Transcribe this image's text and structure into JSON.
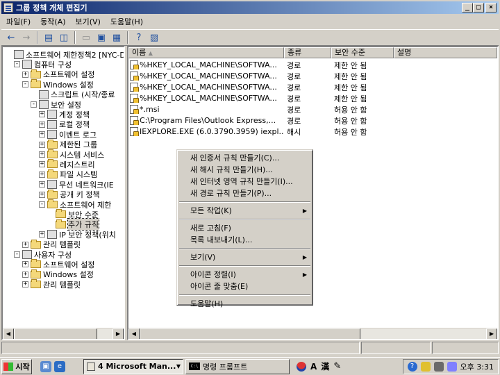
{
  "window": {
    "title": "그룹 정책 개체 편집기",
    "buttons": [
      "_",
      "□",
      "×"
    ]
  },
  "menubar": [
    "파일(F)",
    "동작(A)",
    "보기(V)",
    "도움말(H)"
  ],
  "tree": [
    {
      "label": "소프트웨어 제한정책2 [NYC-D",
      "level": 0,
      "expander": "",
      "icon": "policy-icon"
    },
    {
      "label": "컴퓨터 구성",
      "level": 1,
      "expander": "-",
      "icon": "computer-icon"
    },
    {
      "label": "소프트웨어 설정",
      "level": 2,
      "expander": "+",
      "icon": "folder-icon"
    },
    {
      "label": "Windows 설정",
      "level": 2,
      "expander": "-",
      "icon": "folder-icon"
    },
    {
      "label": "스크립트 (시작/종료",
      "level": 3,
      "expander": "",
      "icon": "script-icon"
    },
    {
      "label": "보안 설정",
      "level": 3,
      "expander": "-",
      "icon": "security-icon"
    },
    {
      "label": "계정 정책",
      "level": 4,
      "expander": "+",
      "icon": "policy-icon"
    },
    {
      "label": "로컬 정책",
      "level": 4,
      "expander": "+",
      "icon": "policy-icon"
    },
    {
      "label": "이벤트 로그",
      "level": 4,
      "expander": "+",
      "icon": "log-icon"
    },
    {
      "label": "제한된 그룹",
      "level": 4,
      "expander": "+",
      "icon": "folder-icon"
    },
    {
      "label": "시스템 서비스",
      "level": 4,
      "expander": "+",
      "icon": "folder-icon"
    },
    {
      "label": "레지스트리",
      "level": 4,
      "expander": "+",
      "icon": "folder-icon"
    },
    {
      "label": "파일 시스템",
      "level": 4,
      "expander": "+",
      "icon": "folder-icon"
    },
    {
      "label": "무선 네트워크(IE",
      "level": 4,
      "expander": "+",
      "icon": "antenna-icon"
    },
    {
      "label": "공개 키 정책",
      "level": 4,
      "expander": "+",
      "icon": "folder-icon"
    },
    {
      "label": "소프트웨어 제한",
      "level": 4,
      "expander": "-",
      "icon": "folder-icon"
    },
    {
      "label": "보안 수준",
      "level": 5,
      "expander": "",
      "icon": "folder-icon"
    },
    {
      "label": "추가 규칙",
      "level": 5,
      "expander": "",
      "icon": "folder-icon",
      "selected": true
    },
    {
      "label": "IP 보안 정책(위치",
      "level": 4,
      "expander": "+",
      "icon": "ip-security-icon"
    },
    {
      "label": "관리 템플릿",
      "level": 2,
      "expander": "+",
      "icon": "folder-icon"
    },
    {
      "label": "사용자 구성",
      "level": 1,
      "expander": "-",
      "icon": "user-icon"
    },
    {
      "label": "소프트웨어 설정",
      "level": 2,
      "expander": "+",
      "icon": "folder-icon"
    },
    {
      "label": "Windows 설정",
      "level": 2,
      "expander": "+",
      "icon": "folder-icon"
    },
    {
      "label": "관리 템플릿",
      "level": 2,
      "expander": "+",
      "icon": "folder-icon"
    }
  ],
  "list": {
    "columns": [
      "이름",
      "종류",
      "보안 수준",
      "설명"
    ],
    "rows": [
      {
        "name": "%HKEY_LOCAL_MACHINE\\SOFTWA...",
        "type": "경로",
        "level": "제한 안 됨",
        "desc": ""
      },
      {
        "name": "%HKEY_LOCAL_MACHINE\\SOFTWA...",
        "type": "경로",
        "level": "제한 안 됨",
        "desc": ""
      },
      {
        "name": "%HKEY_LOCAL_MACHINE\\SOFTWA...",
        "type": "경로",
        "level": "제한 안 됨",
        "desc": ""
      },
      {
        "name": "%HKEY_LOCAL_MACHINE\\SOFTWA...",
        "type": "경로",
        "level": "제한 안 됨",
        "desc": ""
      },
      {
        "name": "*.msi",
        "type": "경로",
        "level": "허용 안 함",
        "desc": ""
      },
      {
        "name": "C:\\Program Files\\Outlook Express,...",
        "type": "경로",
        "level": "허용 안 함",
        "desc": ""
      },
      {
        "name": "IEXPLORE.EXE (6.0.3790.3959)  iexpl...",
        "type": "해시",
        "level": "허용 안 함",
        "desc": ""
      }
    ]
  },
  "context_menu": {
    "groups": [
      [
        {
          "label": "새 인증서 규칙 만들기(C)..."
        },
        {
          "label": "새 해시 규칙 만들기(H)..."
        },
        {
          "label": "새 인터넷 영역 규칙 만들기(I)..."
        },
        {
          "label": "새 경로 규칙 만들기(P)..."
        }
      ],
      [
        {
          "label": "모든 작업(K)",
          "submenu": true
        }
      ],
      [
        {
          "label": "새로 고침(F)"
        },
        {
          "label": "목록 내보내기(L)..."
        }
      ],
      [
        {
          "label": "보기(V)",
          "submenu": true
        }
      ],
      [
        {
          "label": "아이콘 정렬(I)",
          "submenu": true
        },
        {
          "label": "아이콘 줄 맞춤(E)"
        }
      ],
      [
        {
          "label": "도움말(H)"
        }
      ]
    ]
  },
  "taskbar": {
    "start_label": "시작",
    "tasks": [
      {
        "label": "4 Microsoft Man...",
        "active": true
      },
      {
        "label": "명령 프롬프트",
        "active": false
      }
    ],
    "ime": [
      "A",
      "漢"
    ],
    "clock": "오후 3:31"
  }
}
